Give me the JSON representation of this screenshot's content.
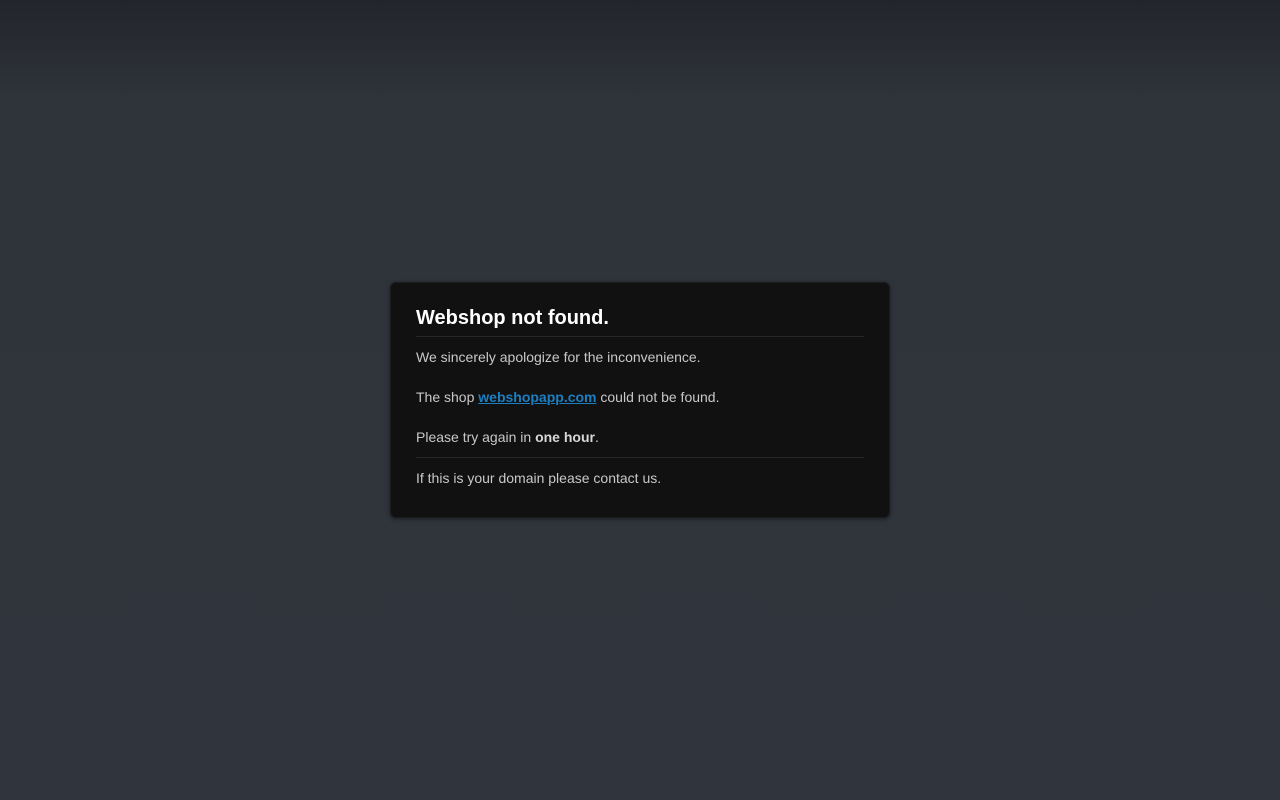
{
  "card": {
    "title": "Webshop not found.",
    "apology": "We sincerely apologize for the inconvenience.",
    "shop_line": {
      "prefix": "The shop ",
      "domain_link": "webshopapp.com",
      "suffix": " could not be found."
    },
    "retry_line": {
      "prefix": "Please try again in ",
      "emphasis": "one hour",
      "suffix": "."
    },
    "contact": "If this is your domain please contact us."
  },
  "colors": {
    "background": "#30343c",
    "card": "#111111",
    "link": "#1c7fc2",
    "title": "#ffffff",
    "text": "#c8c8c8"
  }
}
